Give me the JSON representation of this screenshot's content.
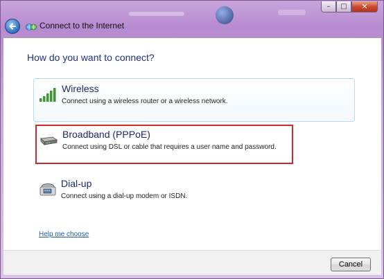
{
  "window": {
    "title": "Connect to the Internet",
    "caption": {
      "minimize": "–",
      "maximize": "□",
      "close": "✕"
    }
  },
  "main": {
    "heading": "How do you want to connect?",
    "options": [
      {
        "title": "Wireless",
        "description": "Connect using a wireless router or a wireless network.",
        "icon": "wireless-signal-icon"
      },
      {
        "title": "Broadband (PPPoE)",
        "description": "Connect using DSL or cable that requires a user name and password.",
        "icon": "broadband-modem-icon",
        "highlighted": true,
        "highlight_color": "#d3262b"
      },
      {
        "title": "Dial-up",
        "description": "Connect using a dial-up modem or ISDN.",
        "icon": "dialup-modem-icon"
      }
    ],
    "help_link": "Help me choose"
  },
  "footer": {
    "cancel_label": "Cancel"
  },
  "colors": {
    "heading": "#1e3287",
    "link": "#1a5fb4",
    "frame": "#c9a5dc",
    "highlight_border": "#d3262b"
  }
}
